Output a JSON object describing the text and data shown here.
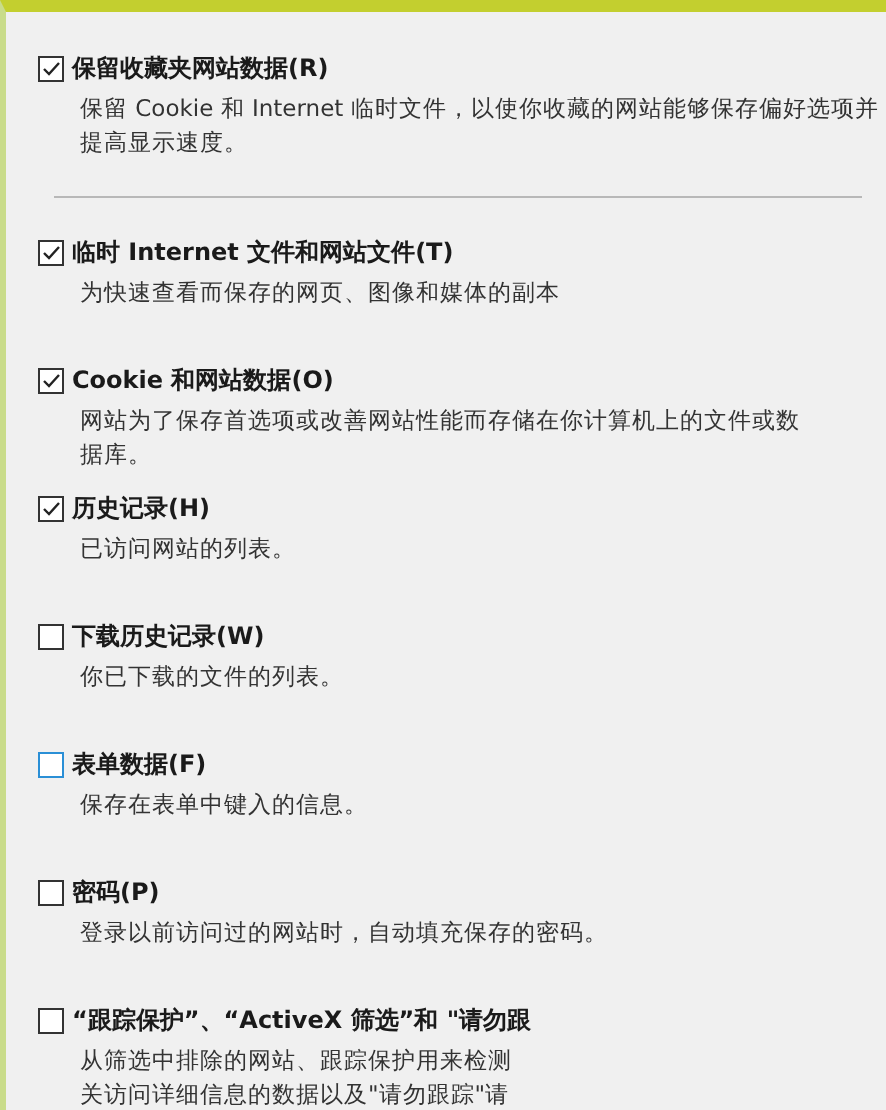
{
  "options": [
    {
      "label": "保留收藏夹网站数据(R)",
      "checked": true,
      "color": "#333333",
      "description": [
        "保留 Cookie 和 Internet 临时文件，以使你收藏的网站能够保存偏好选项并",
        "提高显示速度。"
      ],
      "divider_after": true
    },
    {
      "label": "临时 Internet 文件和网站文件(T)",
      "checked": true,
      "color": "#333333",
      "description": [
        "为快速查看而保存的网页、图像和媒体的副本"
      ],
      "divider_after": false
    },
    {
      "label": "Cookie 和网站数据(O)",
      "checked": true,
      "color": "#333333",
      "description": [
        "网站为了保存首选项或改善网站性能而存储在你计算机上的文件或数",
        "据库。"
      ],
      "divider_after": false
    },
    {
      "label": "历史记录(H)",
      "checked": true,
      "color": "#333333",
      "description": [
        "已访问网站的列表。"
      ],
      "divider_after": false
    },
    {
      "label": "下载历史记录(W)",
      "checked": false,
      "color": "#333333",
      "description": [
        "你已下载的文件的列表。"
      ],
      "divider_after": false
    },
    {
      "label": "表单数据(F)",
      "checked": false,
      "color": "#2a8fd6",
      "description": [
        "保存在表单中键入的信息。"
      ],
      "divider_after": false
    },
    {
      "label": "密码(P)",
      "checked": false,
      "color": "#333333",
      "description": [
        "登录以前访问过的网站时，自动填充保存的密码。"
      ],
      "divider_after": false
    },
    {
      "label": "“跟踪保护”、“ActiveX 筛选”和 \"请勿跟",
      "checked": false,
      "color": "#333333",
      "description": [
        "从筛选中排除的网站、跟踪保护用来检测",
        "关访问详细信息的数据以及\"请勿跟踪\"请"
      ],
      "divider_after": false
    }
  ]
}
